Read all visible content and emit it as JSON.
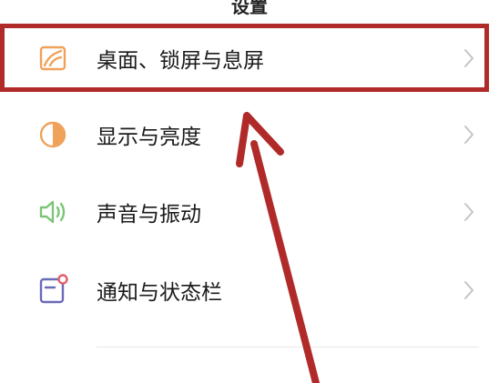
{
  "header": {
    "title": "设置"
  },
  "settings": {
    "items": [
      {
        "label": "桌面、锁屏与息屏",
        "icon": "wallpaper-icon"
      },
      {
        "label": "显示与亮度",
        "icon": "brightness-icon"
      },
      {
        "label": "声音与振动",
        "icon": "speaker-icon"
      },
      {
        "label": "通知与状态栏",
        "icon": "notification-icon"
      }
    ]
  },
  "colors": {
    "icon_orange": "#f0a15a",
    "icon_green": "#7cc576",
    "icon_purple": "#6a6ab8",
    "icon_red_dot": "#e35d6a",
    "annotation_red": "#b12a2a",
    "chevron": "#c4c4c4"
  }
}
